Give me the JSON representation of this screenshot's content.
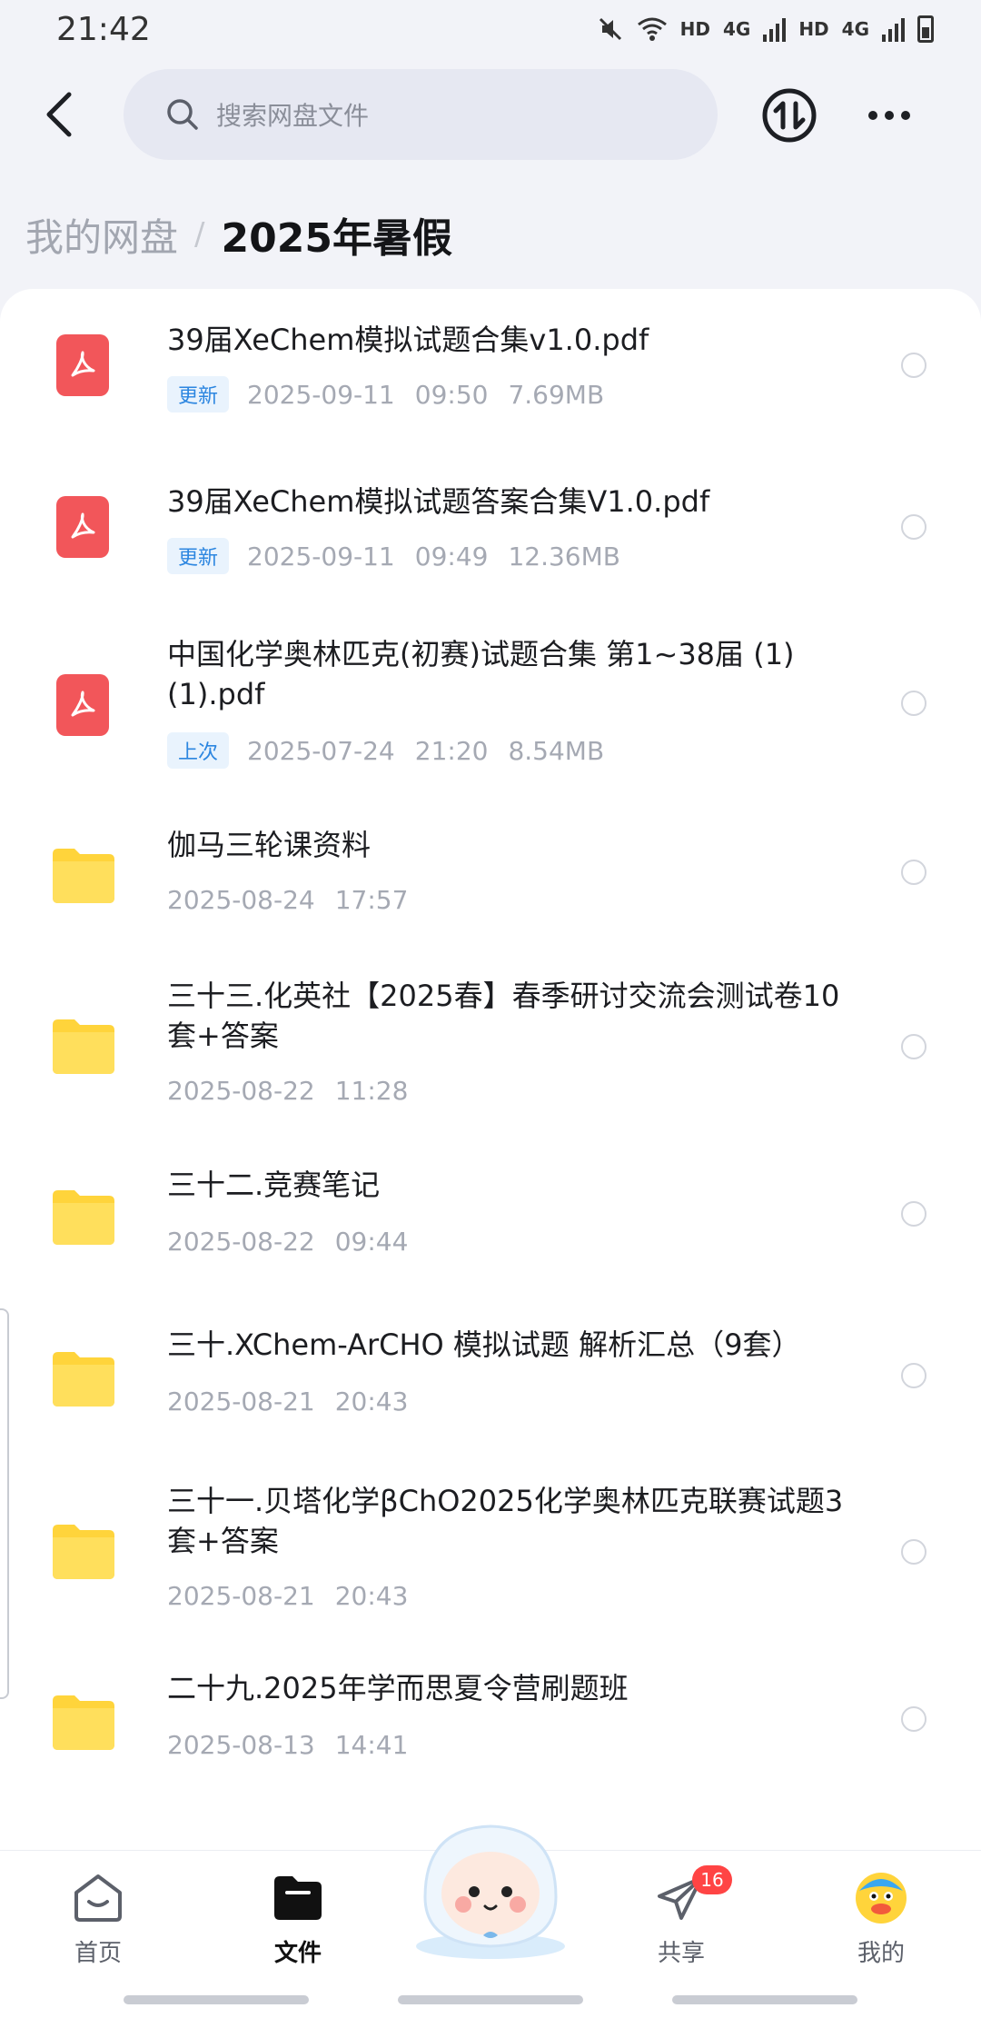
{
  "status_bar": {
    "time": "21:42",
    "hd1": "HD",
    "net1": "4G",
    "hd2": "HD",
    "net2": "4G"
  },
  "search": {
    "placeholder": "搜索网盘文件"
  },
  "breadcrumb": {
    "root": "我的网盘",
    "separator": "/",
    "current": "2025年暑假"
  },
  "files": [
    {
      "type": "pdf",
      "name": "39届XeChem模拟试题合集v1.0.pdf",
      "tag": "更新",
      "date": "2025-09-11",
      "time": "09:50",
      "size": "7.69MB"
    },
    {
      "type": "pdf",
      "name": "39届XeChem模拟试题答案合集V1.0.pdf",
      "tag": "更新",
      "date": "2025-09-11",
      "time": "09:49",
      "size": "12.36MB"
    },
    {
      "type": "pdf",
      "name": "中国化学奥林匹克(初赛)试题合集 第1~38届 (1)(1).pdf",
      "tag": "上次",
      "date": "2025-07-24",
      "time": "21:20",
      "size": "8.54MB"
    },
    {
      "type": "folder",
      "name": "伽马三轮课资料",
      "date": "2025-08-24",
      "time": "17:57"
    },
    {
      "type": "folder",
      "name": "三十三.化英社【2025春】春季研讨交流会测试卷10套+答案",
      "date": "2025-08-22",
      "time": "11:28"
    },
    {
      "type": "folder",
      "name": "三十二.竞赛笔记",
      "date": "2025-08-22",
      "time": "09:44"
    },
    {
      "type": "folder",
      "name": "三十.XChem-ArCHO 模拟试题 解析汇总（9套）",
      "date": "2025-08-21",
      "time": "20:43"
    },
    {
      "type": "folder",
      "name": "三十一.贝塔化学βChO2025化学奥林匹克联赛试题3套+答案",
      "date": "2025-08-21",
      "time": "20:43"
    },
    {
      "type": "folder",
      "name": "二十九.2025年学而思夏令营刷题班",
      "date": "2025-08-13",
      "time": "14:41"
    }
  ],
  "bottom_nav": {
    "home": "首页",
    "files": "文件",
    "share": "共享",
    "share_badge": "16",
    "me": "我的"
  },
  "colors": {
    "pdf": "#f2565a",
    "folder": "#ffd43b",
    "tag_text": "#2c86e0",
    "badge": "#ff4444"
  }
}
